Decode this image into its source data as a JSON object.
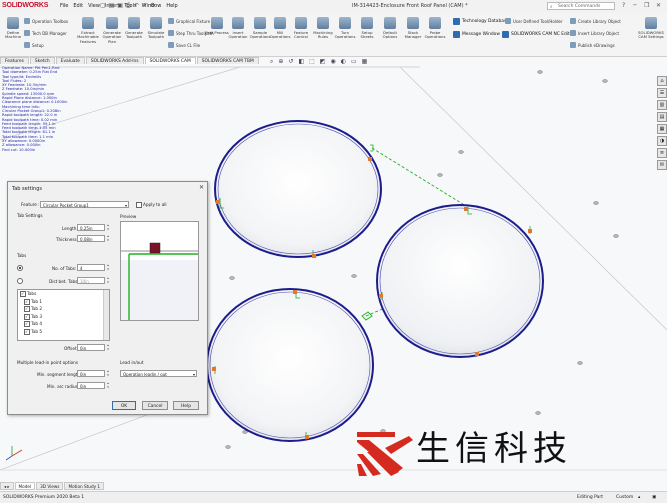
{
  "app": {
    "logo": "SOLIDWORKS",
    "document_title": "IM-314423-Enclosure Front Roof Panel (CAM) *",
    "search_placeholder": "Search Commands",
    "menu": [
      "File",
      "Edit",
      "View",
      "Insert",
      "Tools",
      "Window",
      "Help"
    ]
  },
  "ribbon": {
    "large_buttons": [
      "Define Machine",
      "Extract Machinable Features",
      "Generate Operation Plan",
      "Generate Toolpath",
      "Simulate Toolpath",
      "Step Thru Toolpath",
      "Post Process",
      "Save CL File",
      "Insert Operation",
      "Sample Operations",
      "Mill Operations",
      "Turn Operations",
      "Setup Sheets",
      "Probe Operations"
    ],
    "small_buttons": [
      "Operation Toolbox",
      "Tech DB Manager",
      "Setup",
      "Graphical Fixture",
      "Edit All Toolpaths",
      "Save CL File",
      "Feature Control",
      "Reset Features",
      "Machining Rules",
      "Mill Parameters",
      "Default Options",
      "Calculate Shape",
      "Stock Manager",
      "User Defined Tool/Holder",
      "Create Library Object",
      "Insert Library Object",
      "Publish eDrawings",
      "Process Manager"
    ],
    "highlight_buttons": [
      "Technology Database",
      "Message Window",
      "SOLIDWORKS CAM NC Editor"
    ],
    "extra": "SOLIDWORKS CAM Settings"
  },
  "tabs": [
    "Features",
    "Sketch",
    "Evaluate",
    "SOLIDWORKS Add-Ins",
    "SOLIDWORKS CAM",
    "SOLIDWORKS CAM TBM"
  ],
  "active_tab": 4,
  "operation_info": [
    "Operation Name: Pkt Pen1-Rnd",
    "Tool diameter: 0.25in Flat End",
    "Tool type/id: Endmills",
    "Tool Flutes: 2",
    "XY Feedrate: 10.3in/min",
    "Z Feedrate: 10.0in/min",
    "Spindle speed: 13000.0 rpm",
    "Rapid Plane distance: 1.000in",
    "Clearance plane distance: 0.1000in",
    "Machining time Info:",
    "  Circular Pocket Group1: 0.208in",
    "Rapid toolpath length: 22.0 in",
    "Rapid toolpath time: 0.02 min",
    "Feed toolpath length: 59.1 in",
    "Feed toolpath time: 1.05 min",
    "Total toolpath length: 81.1 in",
    "Total toolpath time: 1.1 min",
    "XY allowance: 0.0000in",
    "Z allowance: 0.000in",
    "Find cut: 10.000in"
  ],
  "task_pane_icons": [
    "home-icon",
    "resources-icon",
    "library-icon",
    "file-explorer-icon",
    "view-palette-icon",
    "appearances-icon",
    "custom-properties-icon",
    "forum-icon"
  ],
  "dialog": {
    "title": "Tab settings",
    "close": "✕",
    "feature_label": "Feature :",
    "feature_value": "Circular Pocket Group1",
    "apply_all_label": "Apply to all",
    "tab_settings_label": "Tab Settings",
    "length_label": "Length:",
    "length_value": "0.25in",
    "thickness_label": "Thickness:",
    "thickness_value": "0.08in",
    "preview_label": "Preview",
    "tabs_group_label": "Tabs",
    "num_tabs_label": "No. of Tabs:",
    "num_tabs_value": "4",
    "dist_tabs_label": "Dist bet. Tabs:",
    "dist_tabs_value": "10in",
    "tabs_list_header": "Tabs",
    "tabs_list": [
      "Tab 1",
      "Tab 2",
      "Tab 3",
      "Tab 4",
      "Tab 5"
    ],
    "offset_label": "Offset:",
    "offset_value": "0in",
    "multiple_leadin_label": "Multiple lead-in point options",
    "min_segment_label": "Min. segment length:",
    "min_segment_value": "0in",
    "min_arc_label": "Min. arc radius:",
    "min_arc_value": "0in",
    "leadinout_label": "Lead in/out",
    "leadinout_value": "Operation leadin / out",
    "ok": "OK",
    "cancel": "Cancel",
    "help": "Help"
  },
  "bottom_tabs": [
    "Model",
    "3D Views",
    "Motion Study 1"
  ],
  "status": {
    "left": "SOLIDWORKS Premium 2020 Beta 1",
    "mode": "Editing Part",
    "units": "Custom"
  },
  "watermark": {
    "text": "生信科技"
  },
  "colors": {
    "toolpath_outline": "#1c1c8c",
    "rapid_move": "#22b022",
    "tab_marker": "#e07a2a",
    "watermark_red": "#d42a20"
  }
}
